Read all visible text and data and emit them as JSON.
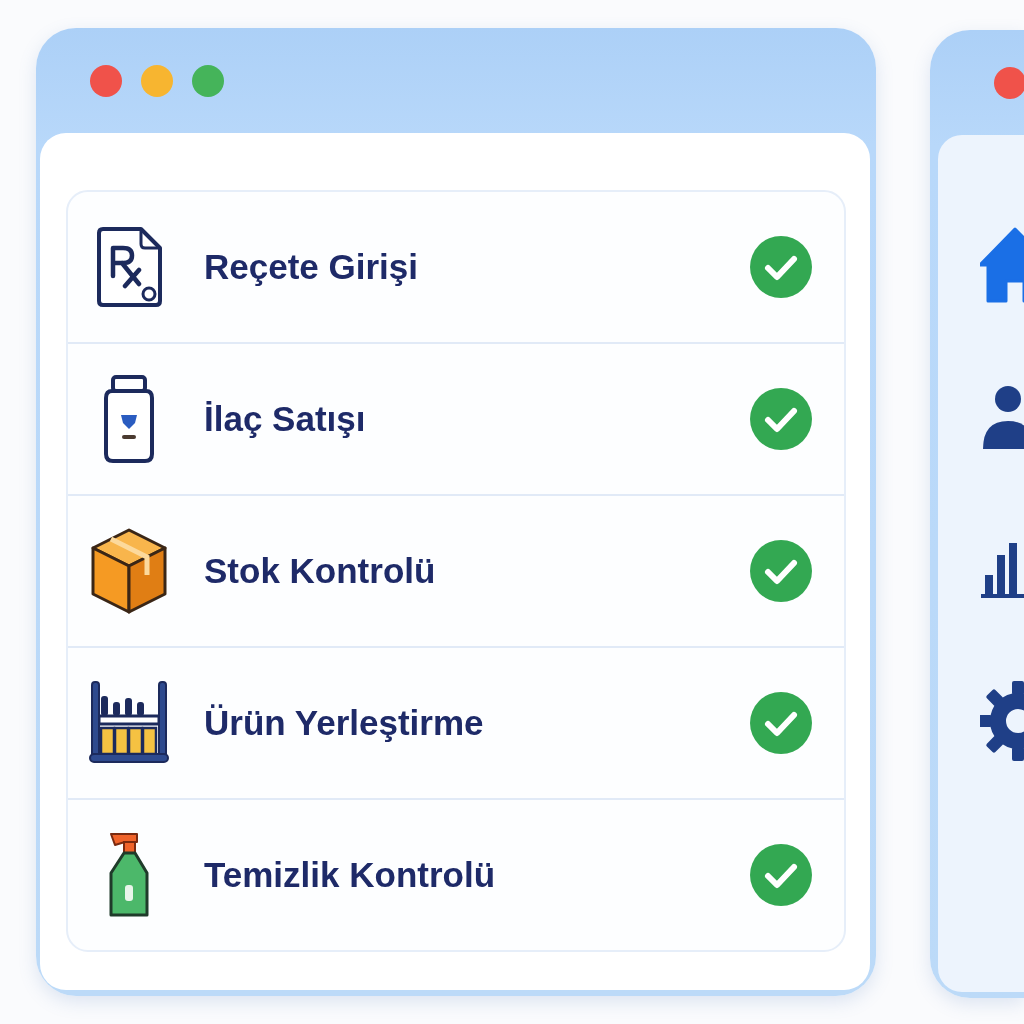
{
  "main_window": {
    "tasks": [
      {
        "kind": "prescription",
        "label": "Reçete Girişi",
        "checked": true
      },
      {
        "kind": "medicine",
        "label": "İlaç Satışı",
        "checked": true
      },
      {
        "kind": "stock",
        "label": "Stok Kontrolü",
        "checked": true
      },
      {
        "kind": "placement",
        "label": "Ürün Yerleştirme",
        "checked": true
      },
      {
        "kind": "cleaning",
        "label": "Temizlik Kontrolü",
        "checked": true
      }
    ]
  },
  "side_window": {
    "nav": [
      {
        "kind": "home",
        "selected": true
      },
      {
        "kind": "user",
        "selected": false
      },
      {
        "kind": "chart",
        "selected": false
      },
      {
        "kind": "settings",
        "selected": false
      }
    ]
  }
}
